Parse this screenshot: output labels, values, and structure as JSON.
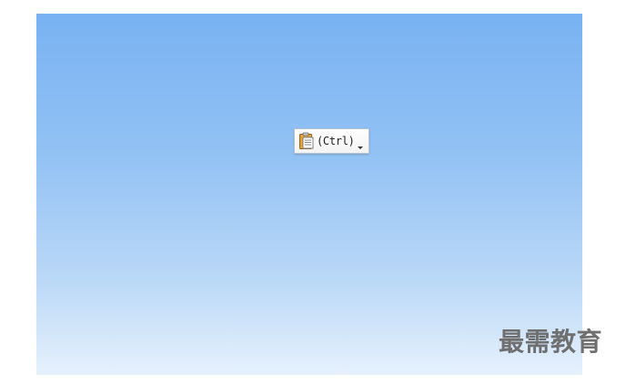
{
  "slide": {
    "background_top_color": "#78b2f2",
    "background_bottom_color": "#e6f1fc"
  },
  "paste_options": {
    "icon": "clipboard-icon",
    "label": "(Ctrl)",
    "dropdown_icon": "chevron-down-icon"
  },
  "watermark": {
    "text": "最需教育"
  }
}
